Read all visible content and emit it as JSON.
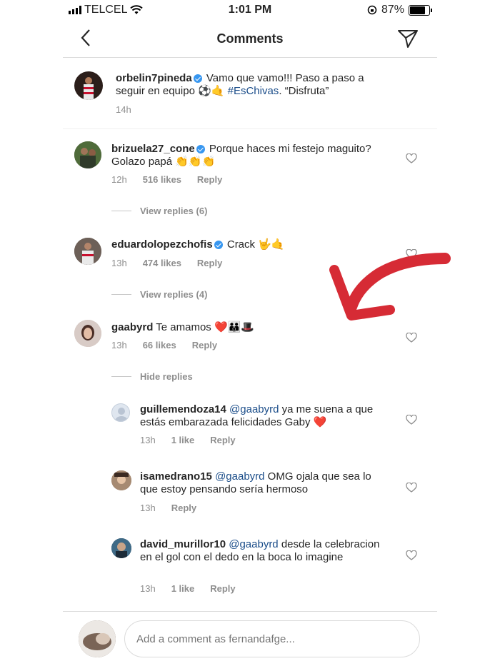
{
  "status": {
    "carrier": "TELCEL",
    "time": "1:01 PM",
    "battery": "87%",
    "battery_level": 0.87
  },
  "header": {
    "title": "Comments"
  },
  "caption": {
    "username": "orbelin7pineda",
    "text_part1": "Vamo que vamo!!! Paso a paso a seguir en equipo ⚽🤙 ",
    "hashtag": "#EsChivas",
    "text_part2": ". “Disfruta”",
    "time": "14h"
  },
  "comments": [
    {
      "username": "brizuela27_cone",
      "text": "Porque haces mi festejo maguito? Golazo papá 👏👏👏",
      "time": "12h",
      "likes": "516 likes",
      "reply": "Reply",
      "view_replies": "View replies (6)"
    },
    {
      "username": "eduardolopezchofis",
      "text": "Crack 🤟🤙",
      "time": "13h",
      "likes": "474 likes",
      "reply": "Reply",
      "view_replies": "View replies (4)"
    },
    {
      "username": "gaabyrd",
      "text": "Te amamos ❤️👪🎩",
      "time": "13h",
      "likes": "66 likes",
      "reply": "Reply",
      "hide_replies": "Hide replies"
    }
  ],
  "replies": [
    {
      "username": "guillemendoza14",
      "mention": "@gaabyrd",
      "text": " ya me suena a que estás embarazada felicidades Gaby ❤️",
      "time": "13h",
      "likes": "1 like",
      "reply": "Reply"
    },
    {
      "username": "isamedrano15",
      "mention": "@gaabyrd",
      "text": " OMG ojala que sea lo que estoy pensando sería hermoso",
      "time": "13h",
      "reply": "Reply"
    },
    {
      "username": "david_murillor10",
      "mention": "@gaabyrd",
      "text": " desde la celebracion en el gol con el dedo en la boca lo imagine",
      "time": "13h",
      "likes": "1 like",
      "reply": "Reply"
    }
  ],
  "composer": {
    "placeholder": "Add a comment as fernandafge..."
  },
  "colors": {
    "annotation_arrow": "#d62b35",
    "verified": "#3897f0",
    "link": "#1c4e8a"
  }
}
